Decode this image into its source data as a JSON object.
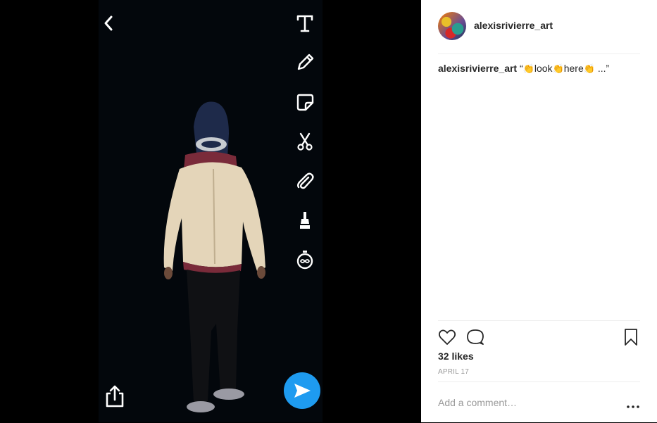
{
  "post": {
    "username": "alexisrivierre_art",
    "caption": {
      "username": "alexisrivierre_art",
      "open_quote": "“",
      "word1": "look",
      "word2": "here",
      "ellipsis": "...”"
    },
    "likes": "32 likes",
    "date": "APRIL 17",
    "comment_placeholder": "Add a comment…"
  },
  "story_tools": [
    "text-icon",
    "pencil-icon",
    "sticker-icon",
    "scissors-icon",
    "paperclip-icon",
    "paintbrush-icon",
    "timer-icon"
  ],
  "colors": {
    "send_button": "#1e9bf0",
    "text_primary": "#262626",
    "text_secondary": "#999999",
    "divider": "#efefef"
  }
}
